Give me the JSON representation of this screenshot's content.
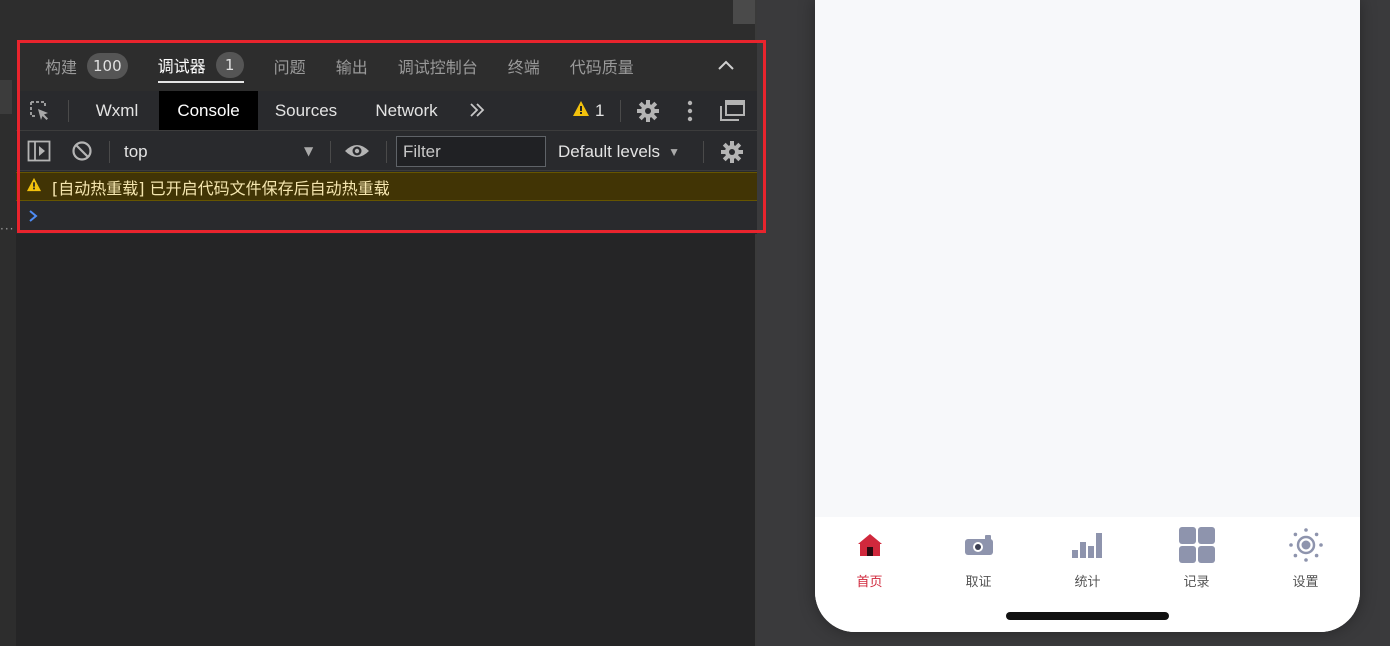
{
  "panel_tabs": [
    {
      "label": "构建",
      "badge": "100"
    },
    {
      "label": "调试器",
      "badge": "1"
    },
    {
      "label": "问题"
    },
    {
      "label": "输出"
    },
    {
      "label": "调试控制台"
    },
    {
      "label": "终端"
    },
    {
      "label": "代码质量"
    }
  ],
  "devtools": {
    "tabs": [
      "Wxml",
      "Console",
      "Sources",
      "Network"
    ],
    "active_tab": "Console",
    "warning_count": "1"
  },
  "console": {
    "context": "top",
    "filter_placeholder": "Filter",
    "levels": "Default levels",
    "warning_message": "[自动热重载] 已开启代码文件保存后自动热重载"
  },
  "simulator": {
    "tabbar": [
      {
        "label": "首页",
        "icon": "home-icon",
        "active": true
      },
      {
        "label": "取证",
        "icon": "camera-icon",
        "active": false
      },
      {
        "label": "统计",
        "icon": "bar-chart-icon",
        "active": false
      },
      {
        "label": "记录",
        "icon": "grid-icon",
        "active": false
      },
      {
        "label": "设置",
        "icon": "settings-sun-icon",
        "active": false
      }
    ]
  },
  "colors": {
    "highlight_border": "#e8242d",
    "active_tab_color": "#d0283c",
    "warning_background": "#413405",
    "inactive_icon_color": "#8e94ad"
  }
}
